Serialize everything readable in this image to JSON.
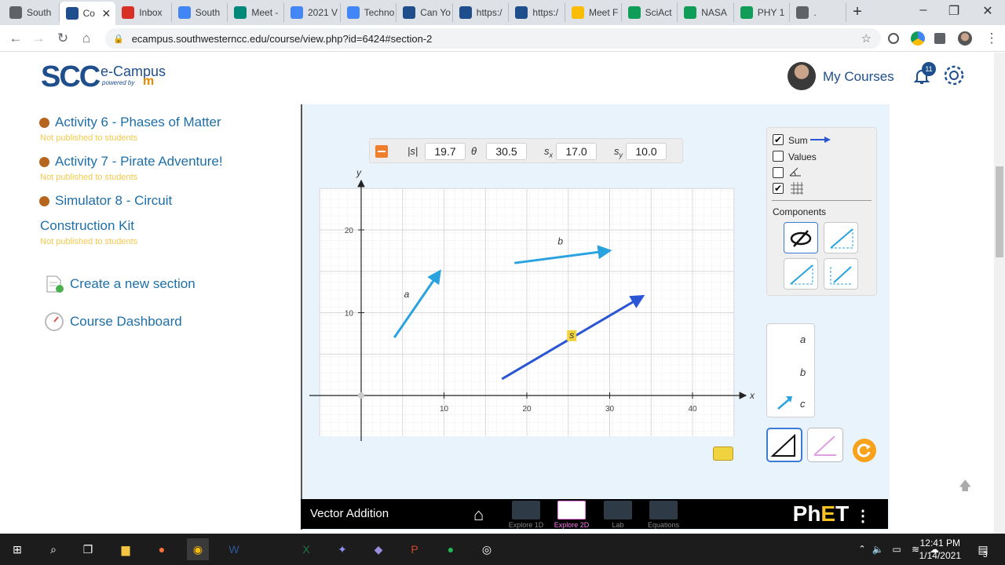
{
  "browser": {
    "tabs": [
      {
        "label": "South",
        "color": "#5f6368",
        "active": false
      },
      {
        "label": "Co",
        "color": "#1e4e8c",
        "active": true
      },
      {
        "label": "Inbox",
        "color": "#d93025",
        "active": false
      },
      {
        "label": "South",
        "color": "#4285f4",
        "active": false
      },
      {
        "label": "Meet -",
        "color": "#00897b",
        "active": false
      },
      {
        "label": "2021 V",
        "color": "#4285f4",
        "active": false
      },
      {
        "label": "Techno",
        "color": "#4285f4",
        "active": false
      },
      {
        "label": "Can Yo",
        "color": "#1e4e8c",
        "active": false
      },
      {
        "label": "https:/",
        "color": "#1e4e8c",
        "active": false
      },
      {
        "label": "https:/",
        "color": "#1e4e8c",
        "active": false
      },
      {
        "label": "Meet F",
        "color": "#fbbc04",
        "active": false
      },
      {
        "label": "SciAct",
        "color": "#0f9d58",
        "active": false
      },
      {
        "label": "NASA",
        "color": "#0f9d58",
        "active": false
      },
      {
        "label": "PHY 1",
        "color": "#0f9d58",
        "active": false
      },
      {
        "label": ".",
        "color": "#5f6368",
        "active": false
      }
    ],
    "url": "ecampus.southwesterncc.edu/course/view.php?id=6424#section-2"
  },
  "header": {
    "logo_main": "SCC",
    "logo_sub": "e-Campus",
    "logo_powered": "powered by",
    "logo_lms": "m",
    "user_link": "My Courses",
    "notification_count": "11"
  },
  "course_nav": {
    "activities": [
      {
        "title": "Activity 6 - Phases of Matter",
        "status": "Not published to students"
      },
      {
        "title": "Activity 7 - Pirate Adventure!",
        "status": "Not published to students"
      },
      {
        "title": "Simulator 8 - Circuit",
        "title_line2": "Construction Kit",
        "status": "Not published to students"
      }
    ],
    "links": [
      "Create a new section",
      "Course Dashboard"
    ]
  },
  "simulation": {
    "name": "Vector Addition",
    "readout": {
      "magnitude_label": "|s|",
      "magnitude_value": "19.7",
      "angle_label": "θ",
      "angle_value": "30.5",
      "sx_label": "s",
      "sx_sub": "x",
      "sx_value": "17.0",
      "sy_label": "s",
      "sy_sub": "y",
      "sy_value": "10.0"
    },
    "checkboxes": [
      {
        "label": "Sum",
        "checked": true
      },
      {
        "label": "Values",
        "checked": false
      },
      {
        "label": "",
        "checked": false
      },
      {
        "label": "",
        "checked": true
      }
    ],
    "components_label": "Components",
    "vector_labels": [
      "a",
      "b",
      "c"
    ],
    "graph": {
      "x_axis_label": "x",
      "y_axis_label": "y",
      "x_ticks": [
        "10",
        "20",
        "30",
        "40"
      ],
      "y_ticks": [
        "10",
        "20"
      ],
      "vectors": [
        {
          "name": "a",
          "tail": [
            4,
            7
          ],
          "tip": [
            9.5,
            15
          ],
          "color": "#29a3e0"
        },
        {
          "name": "b",
          "tail": [
            18.5,
            16
          ],
          "tip": [
            30,
            17.5
          ],
          "color": "#29a3e0"
        },
        {
          "name": "s",
          "tail": [
            17,
            2
          ],
          "tip": [
            34,
            12
          ],
          "color": "#2a55d4"
        }
      ]
    },
    "screens": [
      "Explore 1D",
      "Explore 2D",
      "Lab",
      "Equations"
    ],
    "active_screen": "Explore 2D",
    "brand": "PhET"
  },
  "taskbar": {
    "time": "12:41 PM",
    "date": "1/14/2021",
    "notification_count": "3"
  }
}
